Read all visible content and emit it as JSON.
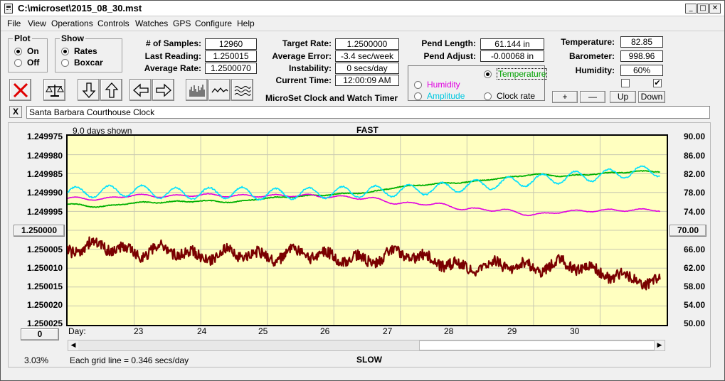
{
  "window": {
    "title": "C:\\microset\\2015_08_30.mst"
  },
  "menu": [
    "File",
    "View",
    "Operations",
    "Controls",
    "Watches",
    "GPS",
    "Configure",
    "Help"
  ],
  "plot": {
    "title": "Plot",
    "on": "On",
    "off": "Off",
    "selected": "On"
  },
  "show": {
    "title": "Show",
    "rates": "Rates",
    "boxcar": "Boxcar",
    "selected": "Rates"
  },
  "stats": {
    "samples_label": "# of Samples:",
    "samples": "12960",
    "last_reading_label": "Last Reading:",
    "last_reading": "1.250015",
    "average_rate_label": "Average Rate:",
    "average_rate": "1.2500070",
    "target_rate_label": "Target Rate:",
    "target_rate": "1.2500000",
    "average_error_label": "Average Error:",
    "average_error": "-3.4 sec/week",
    "instability_label": "Instability:",
    "instability": "0 secs/day",
    "current_time_label": "Current Time:",
    "current_time": "12:00:09 AM",
    "pend_length_label": "Pend Length:",
    "pend_length": "61.144 in",
    "pend_adjust_label": "Pend Adjust:",
    "pend_adjust": "-0.00068 in",
    "temperature_label": "Temperature:",
    "temperature": "82.85",
    "barometer_label": "Barometer:",
    "barometer": "998.96",
    "humidity_label": "Humidity:",
    "humidity": "60%"
  },
  "app_caption": "MicroSet Clock and Watch Timer",
  "overlay": {
    "temperature": "Temperature",
    "humidity": "Humidity",
    "amplitude": "Amplitude",
    "clock_rate": "Clock rate",
    "selected": "Temperature"
  },
  "checkboxes": {
    "left": false,
    "right": true,
    "checkmark": "✔"
  },
  "adjust_buttons": {
    "plus": "+",
    "minus": "—",
    "up": "Up",
    "down": "Down"
  },
  "toolbar_icons": [
    "close-x-icon",
    "balance-scale-icon",
    "arrow-down-icon",
    "arrow-up-icon",
    "arrow-left-icon",
    "arrow-right-icon",
    "bar-graph-icon",
    "wave-icon",
    "multi-wave-icon"
  ],
  "clock": {
    "close": "X",
    "name": "Santa Barbara Courthouse Clock"
  },
  "chart": {
    "days_shown": "9.0 days shown",
    "fast_label": "FAST",
    "slow_label": "SLOW",
    "day_label": "Day:",
    "grid_note": "Each grid line = 0.346 secs/day",
    "percent": "3.03%",
    "center_button": "1.250000",
    "right_button": "70.00",
    "bottom_button": "0"
  },
  "colors": {
    "plot_bg": "#ffffc0",
    "rate": "#7a0000",
    "temperature": "#00b000",
    "humidity": "#e000e0",
    "amplitude": "#00e0ff"
  },
  "chart_data": {
    "type": "line",
    "title": "",
    "xlabel": "Day:",
    "x_ticks": [
      23,
      24,
      25,
      26,
      27,
      28,
      29,
      30
    ],
    "xlim": [
      22.0,
      31.0
    ],
    "y_left_ticks": [
      "1.249975",
      "1.249980",
      "1.249985",
      "1.249990",
      "1.249995",
      "1.250000",
      "1.250005",
      "1.250010",
      "1.250015",
      "1.250020",
      "1.250025"
    ],
    "y_left_lim": [
      1.249975,
      1.250025
    ],
    "y_left_inverted": true,
    "y_right_ticks": [
      "90.00",
      "86.00",
      "82.00",
      "78.00",
      "74.00",
      "70.00",
      "66.00",
      "62.00",
      "58.00",
      "54.00",
      "50.00"
    ],
    "y_right_lim": [
      50,
      90
    ],
    "grid": true,
    "series": [
      {
        "name": "Clock rate",
        "axis": "left",
        "x": [
          22.0,
          22.5,
          23.0,
          23.5,
          24.0,
          24.5,
          25.0,
          25.5,
          26.0,
          26.5,
          27.0,
          27.5,
          28.0,
          28.5,
          29.0,
          29.5,
          30.0,
          30.5,
          30.9
        ],
        "y": [
          1.250005,
          1.250004,
          1.250006,
          1.250005,
          1.250007,
          1.250006,
          1.250007,
          1.250006,
          1.250007,
          1.250008,
          1.250006,
          1.250008,
          1.25001,
          1.250009,
          1.25001,
          1.250009,
          1.250011,
          1.250013,
          1.250014
        ]
      },
      {
        "name": "Temperature",
        "axis": "right",
        "x": [
          22.0,
          22.5,
          23.0,
          23.5,
          24.0,
          24.5,
          25.0,
          25.5,
          26.0,
          26.5,
          27.0,
          27.5,
          28.0,
          28.5,
          29.0,
          29.5,
          30.0,
          30.5,
          30.9
        ],
        "y": [
          75.5,
          75.0,
          75.8,
          76.0,
          76.2,
          76.0,
          76.8,
          77.2,
          77.6,
          78.0,
          79.2,
          79.8,
          80.2,
          81.0,
          81.8,
          81.5,
          82.0,
          82.4,
          82.5
        ]
      },
      {
        "name": "Humidity",
        "axis": "right",
        "x": [
          22.0,
          22.5,
          23.0,
          23.5,
          24.0,
          24.5,
          25.0,
          25.5,
          26.0,
          26.5,
          27.0,
          27.5,
          28.0,
          28.5,
          29.0,
          29.5,
          30.0,
          30.5,
          30.9
        ],
        "y": [
          76.8,
          76.6,
          77.4,
          77.2,
          77.5,
          77.3,
          77.3,
          77.4,
          77.1,
          76.8,
          75.7,
          75.6,
          74.5,
          74.3,
          73.3,
          74.0,
          74.2,
          74.3,
          74.3
        ]
      },
      {
        "name": "Amplitude",
        "axis": "right",
        "x": [
          22.0,
          22.5,
          23.0,
          23.5,
          24.0,
          24.5,
          25.0,
          25.5,
          26.0,
          26.5,
          27.0,
          27.5,
          28.0,
          28.5,
          29.0,
          29.5,
          30.0,
          30.5,
          30.9
        ],
        "y": [
          78.0,
          78.2,
          78.4,
          77.8,
          77.8,
          78.0,
          77.6,
          77.8,
          78.0,
          78.2,
          78.4,
          78.8,
          79.4,
          80.0,
          80.6,
          81.2,
          81.6,
          82.4,
          82.6
        ]
      }
    ]
  }
}
